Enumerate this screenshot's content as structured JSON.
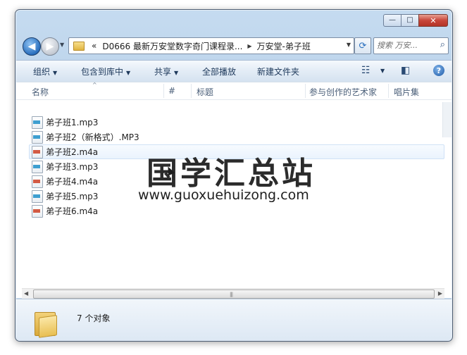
{
  "window": {
    "caption_buttons": {
      "minimize": "—",
      "maximize": "□",
      "close": "✕"
    }
  },
  "nav": {
    "back_glyph": "◀",
    "forward_glyph": "▶",
    "history_dropdown": "▼"
  },
  "address": {
    "overflow": "«",
    "crumbs": [
      "D0666 最新万安堂数字奇门课程录...",
      "万安堂-弟子班"
    ],
    "separator": "▶",
    "dropdown": "▼",
    "refresh_glyph": "⟳"
  },
  "search": {
    "placeholder": "搜索 万安...",
    "icon": "⌕"
  },
  "toolbar": {
    "organize": "组织",
    "include_in_library": "包含到库中",
    "share": "共享",
    "play_all": "全部播放",
    "new_folder": "新建文件夹",
    "dropdown": "▼",
    "view_icon": "☷",
    "preview_icon": "◧",
    "help": "?"
  },
  "columns": {
    "name": "名称",
    "number": "#",
    "title": "标题",
    "artists": "参与创作的艺术家",
    "album": "唱片集",
    "sort_arrow": "^"
  },
  "files": [
    {
      "name": "弟子班1.mp3",
      "type": "mp3"
    },
    {
      "name": "弟子班2（新格式）.MP3",
      "type": "mp3"
    },
    {
      "name": "弟子班2.m4a",
      "type": "m4a"
    },
    {
      "name": "弟子班3.mp3",
      "type": "mp3"
    },
    {
      "name": "弟子班4.m4a",
      "type": "m4a"
    },
    {
      "name": "弟子班5.mp3",
      "type": "mp3"
    },
    {
      "name": "弟子班6.m4a",
      "type": "m4a"
    }
  ],
  "hovered_row": 2,
  "scrollbar": {
    "left": "◀",
    "right": "▶",
    "grip": "|||"
  },
  "status": {
    "count": "7 个对象"
  },
  "watermark": {
    "title": "国学汇总站",
    "url": "www.guoxuehuizong.com"
  }
}
